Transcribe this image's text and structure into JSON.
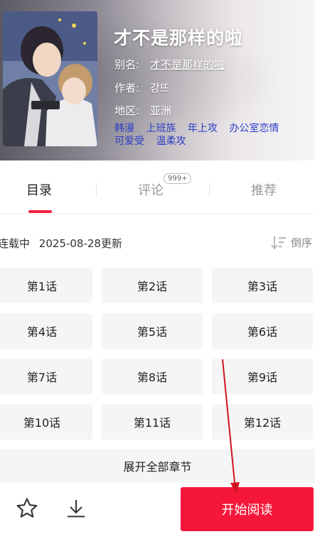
{
  "comic": {
    "title": "才不是那样的啦",
    "alias_label": "别名:",
    "alias_value": "才不是那样的啦",
    "author_label": "作者:",
    "author_value": "강뜨",
    "region_label": "地区:",
    "region_value": "亚洲",
    "tags": [
      "韩漫",
      "上班族",
      "年上攻",
      "办公室恋情",
      "可爱受",
      "温柔攻"
    ]
  },
  "tabs": [
    {
      "label": "目录",
      "active": true
    },
    {
      "label": "评论",
      "badge": "999+"
    },
    {
      "label": "推荐"
    }
  ],
  "status": {
    "state": "连载中",
    "updated": "2025-08-28更新",
    "sort_label": "倒序"
  },
  "chapters": [
    "第1话",
    "第2话",
    "第3话",
    "第4话",
    "第5话",
    "第6话",
    "第7话",
    "第8话",
    "第9话",
    "第10话",
    "第11话",
    "第12话"
  ],
  "expand_label": "展开全部章节",
  "bottom": {
    "favorite_icon": "star-outline-icon",
    "download_icon": "download-icon",
    "read_label": "开始阅读"
  },
  "colors": {
    "accent": "#f5173a",
    "tag": "#2a3ec7"
  }
}
